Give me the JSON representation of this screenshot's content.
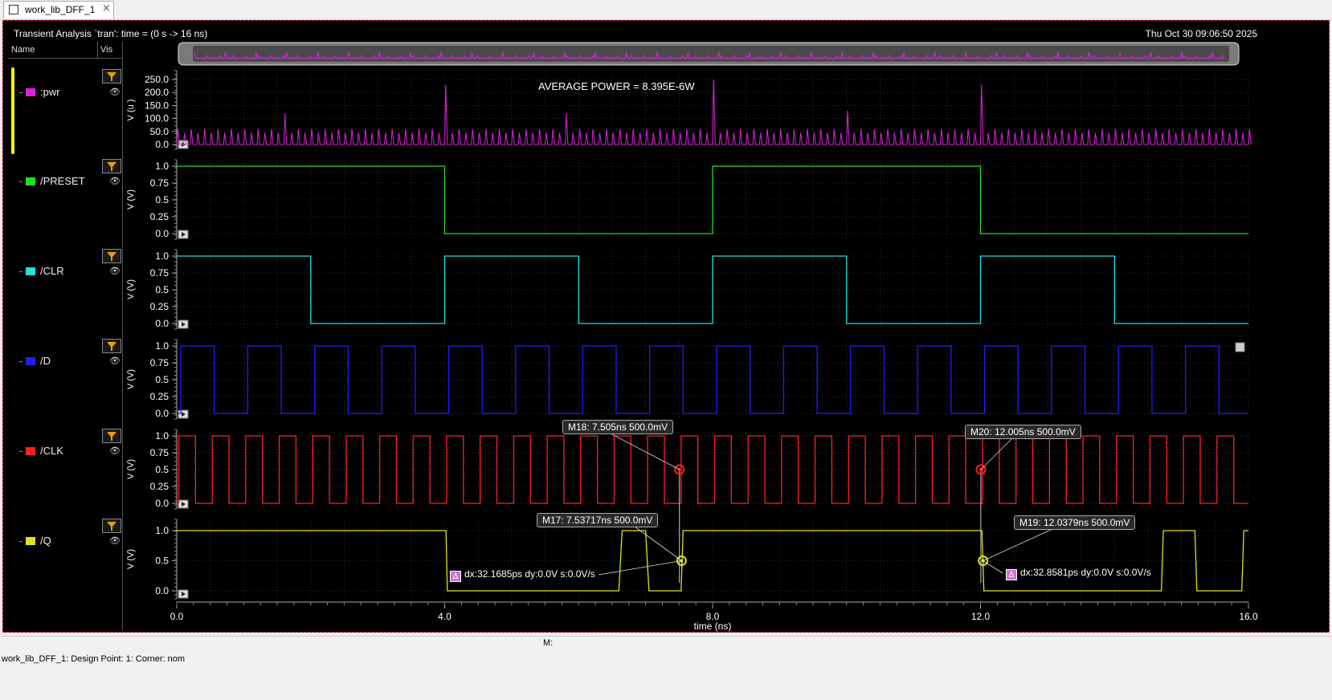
{
  "tab": {
    "label": "work_lib_DFF_1",
    "close": "×"
  },
  "header": {
    "analysis": "Transient Analysis `tran': time = (0 s -> 16 ns)",
    "timestamp": "Thu Oct 30 09:06:50 2025"
  },
  "sidebar": {
    "col_name": "Name",
    "col_vis": "Vis",
    "signals": [
      {
        "label": ":pwr",
        "color": "#e020e0"
      },
      {
        "label": "/PRESET",
        "color": "#20e020"
      },
      {
        "label": "/CLR",
        "color": "#20e0e0"
      },
      {
        "label": "/D",
        "color": "#2020ff"
      },
      {
        "label": "/CLK",
        "color": "#ff2020"
      },
      {
        "label": "/Q",
        "color": "#e0e020"
      }
    ]
  },
  "annotations": {
    "avg_power": "AVERAGE POWER = 8.395E-6W",
    "m18": "M18: 7.505ns 500.0mV",
    "m20": "M20: 12.005ns 500.0mV",
    "m17": "M17: 7.53717ns 500.0mV",
    "m19": "M19: 12.0379ns 500.0mV",
    "delta1": "dx:32.1685ps dy:0.0V s:0.0V/s",
    "delta2": "dx:32.8581ps dy:0.0V s:0.0V/s",
    "delta_icon": "Δ"
  },
  "chart_data": {
    "type": "line",
    "xlabel": "time (ns)",
    "xlim": [
      0,
      16
    ],
    "xticks": [
      "0.0",
      "4.0",
      "8.0",
      "12.0",
      "16.0"
    ],
    "panels": [
      {
        "name": ":pwr",
        "ylabel": "V (u )",
        "yticks": [
          "250.0",
          "200.0",
          "150.0",
          "100.0",
          "50.0",
          "0.0"
        ],
        "ylim": [
          0,
          250
        ]
      },
      {
        "name": "/PRESET",
        "ylabel": "V (V)",
        "yticks": [
          "1.0",
          "0.75",
          "0.5",
          "0.25",
          "0.0"
        ],
        "ylim": [
          0,
          1
        ],
        "x": [
          0,
          4,
          4,
          8,
          8,
          12,
          12,
          16
        ],
        "y": [
          1,
          1,
          0,
          0,
          1,
          1,
          0,
          0
        ]
      },
      {
        "name": "/CLR",
        "ylabel": "V (V)",
        "yticks": [
          "1.0",
          "0.75",
          "0.5",
          "0.25",
          "0.0"
        ],
        "ylim": [
          0,
          1
        ],
        "x": [
          0,
          2,
          2,
          4,
          4,
          6,
          6,
          8,
          8,
          10,
          10,
          12,
          12,
          14,
          14,
          16
        ],
        "y": [
          1,
          1,
          0,
          0,
          1,
          1,
          0,
          0,
          1,
          1,
          0,
          0,
          1,
          1,
          0,
          0
        ]
      },
      {
        "name": "/D",
        "ylabel": "V (V)",
        "yticks": [
          "1.0",
          "0.75",
          "0.5",
          "0.25",
          "0.0"
        ],
        "ylim": [
          0,
          1
        ],
        "period_ns": 1
      },
      {
        "name": "/CLK",
        "ylabel": "V (V)",
        "yticks": [
          "1.0",
          "0.75",
          "0.5",
          "0.25",
          "0.0"
        ],
        "ylim": [
          0,
          1
        ],
        "period_ns": 0.5
      },
      {
        "name": "/Q",
        "ylabel": "V (V)",
        "yticks": [
          "1.0",
          "0.5",
          "0.0"
        ],
        "ylim": [
          0,
          1
        ],
        "x": [
          0,
          4.02,
          4.04,
          6.6,
          6.65,
          7.0,
          7.05,
          7.53,
          7.56,
          12.02,
          12.05,
          14.7,
          14.73,
          15.2,
          15.23,
          15.9,
          15.93,
          16
        ],
        "y": [
          1,
          1,
          0,
          0,
          1,
          1,
          0,
          0,
          1,
          1,
          0,
          0,
          1,
          1,
          0,
          0,
          1,
          1
        ]
      }
    ],
    "markers": [
      {
        "id": "M18",
        "x": 7.505,
        "y": 0.5,
        "panel": "/CLK"
      },
      {
        "id": "M20",
        "x": 12.005,
        "y": 0.5,
        "panel": "/CLK"
      },
      {
        "id": "M17",
        "x": 7.53717,
        "y": 0.5,
        "panel": "/Q"
      },
      {
        "id": "M19",
        "x": 12.0379,
        "y": 0.5,
        "panel": "/Q"
      }
    ]
  },
  "status_m": "M:",
  "footer": "work_lib_DFF_1: Design Point: 1: Corner: nom"
}
